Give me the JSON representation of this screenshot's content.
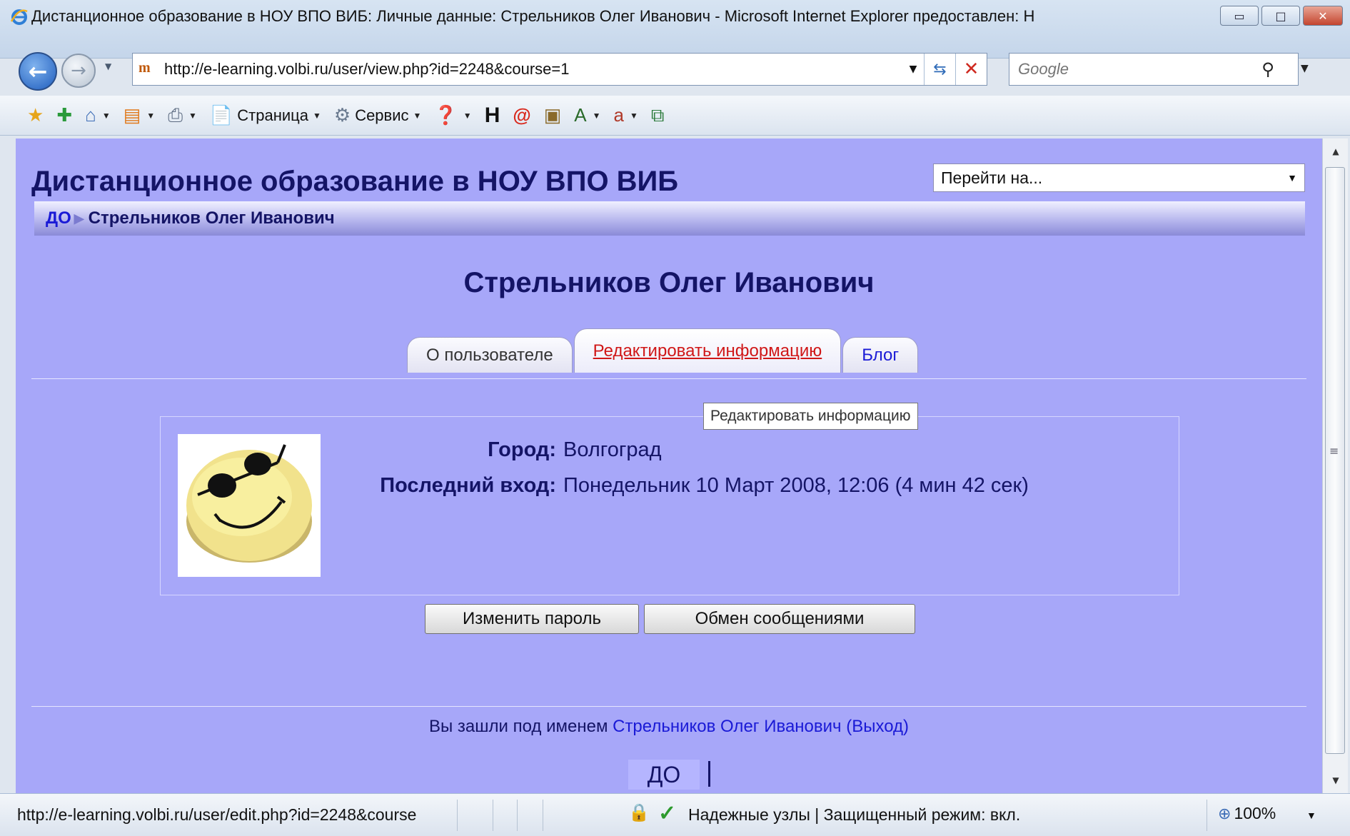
{
  "window": {
    "title": "Дистанционное образование в НОУ ВПО ВИБ: Личные данные: Стрельников Олег Иванович - Microsoft Internet Explorer предоставлен: Н"
  },
  "address": {
    "url": "http://e-learning.volbi.ru/user/view.php?id=2248&course=1"
  },
  "search": {
    "placeholder": "Google"
  },
  "toolbar": {
    "page_label": "Страница",
    "tools_label": "Сервис"
  },
  "page": {
    "site_title": "Дистанционное образование в НОУ ВПО ВИБ",
    "jump_label": "Перейти на...",
    "breadcrumb": {
      "home": "ДО",
      "current": "Стрельников Олег Иванович"
    },
    "user_name": "Стрельников Олег Иванович",
    "tabs": [
      {
        "label": "О пользователе"
      },
      {
        "label": "Редактировать информацию"
      },
      {
        "label": "Блог"
      }
    ],
    "tooltip": "Редактировать информацию",
    "profile": {
      "city_label": "Город:",
      "city_value": "Волгоград",
      "last_login_label": "Последний вход:",
      "last_login_value": "Понедельник 10 Март 2008, 12:06  (4 мин 42 сек)"
    },
    "buttons": {
      "change_password": "Изменить пароль",
      "messaging": "Обмен сообщениями"
    },
    "footer": {
      "logged_as": "Вы зашли под именем",
      "user_link": "Стрельников Олег Иванович",
      "logout": "(Выход)",
      "home": "ДО"
    }
  },
  "status": {
    "url": "http://e-learning.volbi.ru/user/edit.php?id=2248&course",
    "zone": "Надежные узлы | Защищенный режим: вкл.",
    "zoom": "100%"
  },
  "colors": {
    "page_bg": "#a7a7f9",
    "heading": "#141466",
    "link": "#1a1ad6",
    "active_tab_link": "#d01717"
  }
}
